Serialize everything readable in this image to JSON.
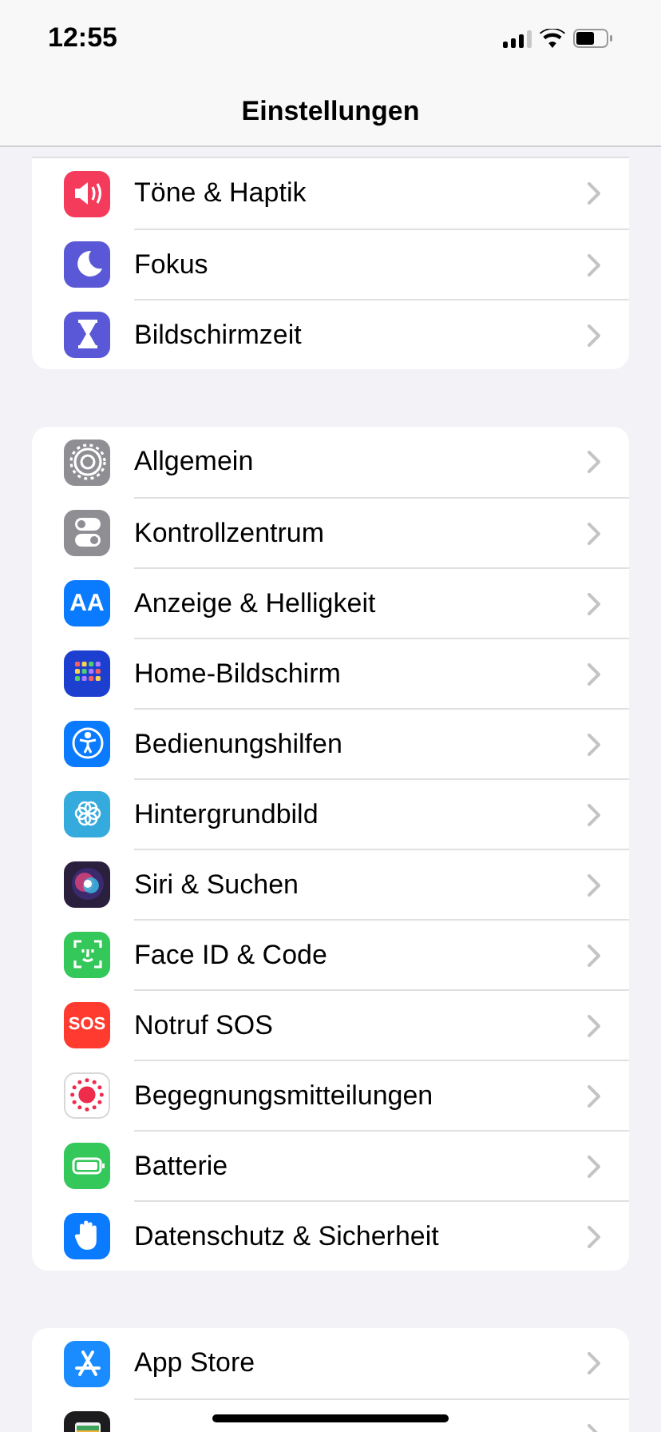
{
  "status_bar": {
    "time": "12:55"
  },
  "nav": {
    "title": "Einstellungen"
  },
  "groups": [
    {
      "clipped_top": true,
      "items": [
        {
          "label": "Töne & Haptik",
          "color": "#f43b5b"
        },
        {
          "label": "Fokus",
          "color": "#5a58d6"
        },
        {
          "label": "Bildschirmzeit",
          "color": "#5a58d6"
        }
      ]
    },
    {
      "clipped_top": false,
      "items": [
        {
          "label": "Allgemein",
          "color": "#8e8e93"
        },
        {
          "label": "Kontrollzentrum",
          "color": "#8e8e93"
        },
        {
          "label": "Anzeige & Helligkeit",
          "color": "#0a7aff",
          "badge": "AA"
        },
        {
          "label": "Home-Bildschirm",
          "color": "#1d3fcf"
        },
        {
          "label": "Bedienungshilfen",
          "color": "#0a7aff"
        },
        {
          "label": "Hintergrundbild",
          "color": "#35aadc"
        },
        {
          "label": "Siri & Suchen",
          "color": "#2a1f3d"
        },
        {
          "label": "Face ID & Code",
          "color": "#34c759"
        },
        {
          "label": "Notruf SOS",
          "color": "#ff3b30",
          "badge": "SOS"
        },
        {
          "label": "Begegnungsmitteilungen",
          "color": "#ffffff"
        },
        {
          "label": "Batterie",
          "color": "#34c759"
        },
        {
          "label": "Datenschutz & Sicherheit",
          "color": "#0a7aff"
        }
      ]
    },
    {
      "clipped_top": false,
      "items": [
        {
          "label": "App Store",
          "color": "#1a8cff"
        },
        {
          "color": "#1c1c1e"
        }
      ]
    }
  ]
}
